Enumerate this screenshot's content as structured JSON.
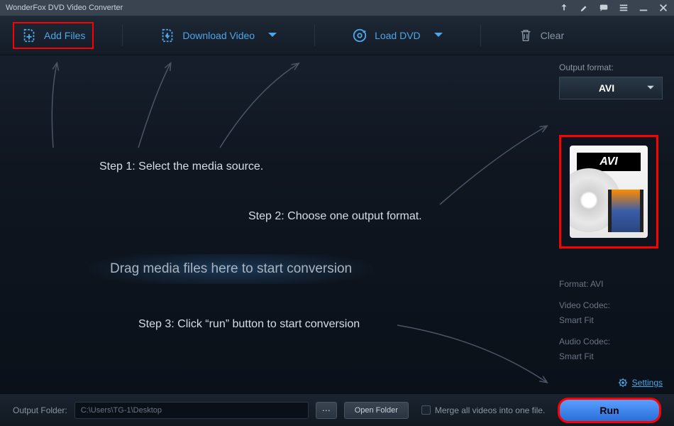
{
  "titlebar": {
    "title": "WonderFox DVD Video Converter"
  },
  "toolbar": {
    "add_files": "Add Files",
    "download_video": "Download Video",
    "load_dvd": "Load DVD",
    "clear": "Clear"
  },
  "steps": {
    "step1": "Step 1: Select the media source.",
    "step2": "Step 2: Choose one output format.",
    "step3": "Step 3: Click “run” button to start conversion",
    "drag_hint": "Drag media files here to start conversion"
  },
  "side": {
    "output_format_label": "Output format:",
    "selected_format": "AVI",
    "icon_badge": "AVI",
    "info": {
      "format_label": "Format:",
      "format_value": "AVI",
      "video_codec_label": "Video Codec:",
      "video_codec_value": "Smart Fit",
      "audio_codec_label": "Audio Codec:",
      "audio_codec_value": "Smart Fit"
    },
    "settings_link": "Settings"
  },
  "bottom": {
    "output_folder_label": "Output Folder:",
    "output_folder_path": "C:\\Users\\TG-1\\Desktop",
    "browse": "⋯",
    "open_folder": "Open Folder",
    "merge_label": "Merge all videos into one file.",
    "run_label": "Run"
  }
}
